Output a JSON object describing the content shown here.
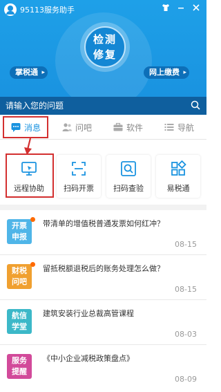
{
  "header": {
    "app_title": "95113服务助手",
    "circle_line1": "检测",
    "circle_line2": "修复",
    "left_pill": "掌税通",
    "right_pill": "网上缴费",
    "icons": [
      "shirt-icon",
      "minimize-icon",
      "close-icon"
    ]
  },
  "search": {
    "placeholder": "请输入您的问题"
  },
  "tabs": [
    {
      "label": "消息",
      "icon": "chat-icon",
      "active": true
    },
    {
      "label": "问吧",
      "icon": "people-icon"
    },
    {
      "label": "软件",
      "icon": "briefcase-icon"
    },
    {
      "label": "导航",
      "icon": "list-icon"
    }
  ],
  "tools": [
    {
      "label": "远程协助",
      "icon": "monitor-icon"
    },
    {
      "label": "扫码开票",
      "icon": "scan-icon"
    },
    {
      "label": "扫码查验",
      "icon": "search-scan-icon"
    },
    {
      "label": "易税通",
      "icon": "grid-icon"
    }
  ],
  "messages": [
    {
      "badge_line1": "开票",
      "badge_line2": "申报",
      "badge_color": "#4fb5e8",
      "unread": true,
      "text": "带清单的增值税普通发票如何红冲？",
      "date": "08-15"
    },
    {
      "badge_line1": "财税",
      "badge_line2": "问吧",
      "badge_color": "#f0a030",
      "unread": true,
      "text": "留抵税额退税后的账务处理怎么做？",
      "date": "08-15"
    },
    {
      "badge_line1": "航信",
      "badge_line2": "学堂",
      "badge_color": "#3cb8c8",
      "unread": false,
      "text": "建筑安装行业总裁高管课程",
      "date": "08-03"
    },
    {
      "badge_line1": "服务",
      "badge_line2": "提醒",
      "badge_color": "#d24a9a",
      "unread": false,
      "text": "《中小企业减税政策盘点》",
      "date": "08-09"
    }
  ],
  "colors": {
    "header": "#1a93e0",
    "search_bar": "#0f5f9e",
    "highlight": "#d32f2f"
  }
}
